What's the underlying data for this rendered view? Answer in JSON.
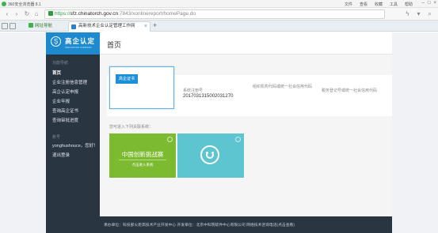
{
  "browser": {
    "title": "360安全浏览器 8.1",
    "menus": [
      "文件",
      "查看",
      "收藏",
      "工具",
      "帮助"
    ],
    "url_https": "https://",
    "url_domain": "sfz.chinatorch.gov.cn",
    "url_rest": ":7843/xonlinereport/homePage.do",
    "fav_label": "网址导航",
    "tab_title": "高新技术企业认定管理工作网",
    "newtab": "+"
  },
  "sidebar": {
    "logo_title": "高企认定",
    "logo_sub": "INNOVATION COMPANY",
    "group_title": "功能导航",
    "items": [
      {
        "label": "首页"
      },
      {
        "label": "企业注册信息管理"
      },
      {
        "label": "高企认定申报"
      },
      {
        "label": "企业年报"
      },
      {
        "label": "查询高企证书"
      },
      {
        "label": "查询审批进度"
      }
    ],
    "account_group": "账号",
    "user_greeting": "yonghushouce，您好！",
    "logout": "退出登录"
  },
  "main": {
    "page_title": "首页",
    "cert_button": "高企证书",
    "fields": {
      "reg_no_label": "系统注册号",
      "reg_no_value": "2017031315002031270",
      "org_code_label": "组织机构代码或统一社会信用代码",
      "tax_label": "税务登记号或统一社会信用代码"
    },
    "system_label": "您可进入下列关联系统：",
    "systems": {
      "green_title": "中国创新挑战赛",
      "green_enter": "点击进入系统"
    }
  },
  "footer": {
    "text": "承办单位：科技部火炬高技术产业开发中心    开发单位：北京中科院软件中心有限公司    网络技术咨询电话(点击查看)"
  },
  "colors": {
    "sidebar_bg": "#2a3542",
    "logo_bg": "#1d8ad0",
    "accent_blue": "#1e90d8",
    "card_green": "#7cba2f",
    "card_cyan": "#5cc5cf"
  }
}
